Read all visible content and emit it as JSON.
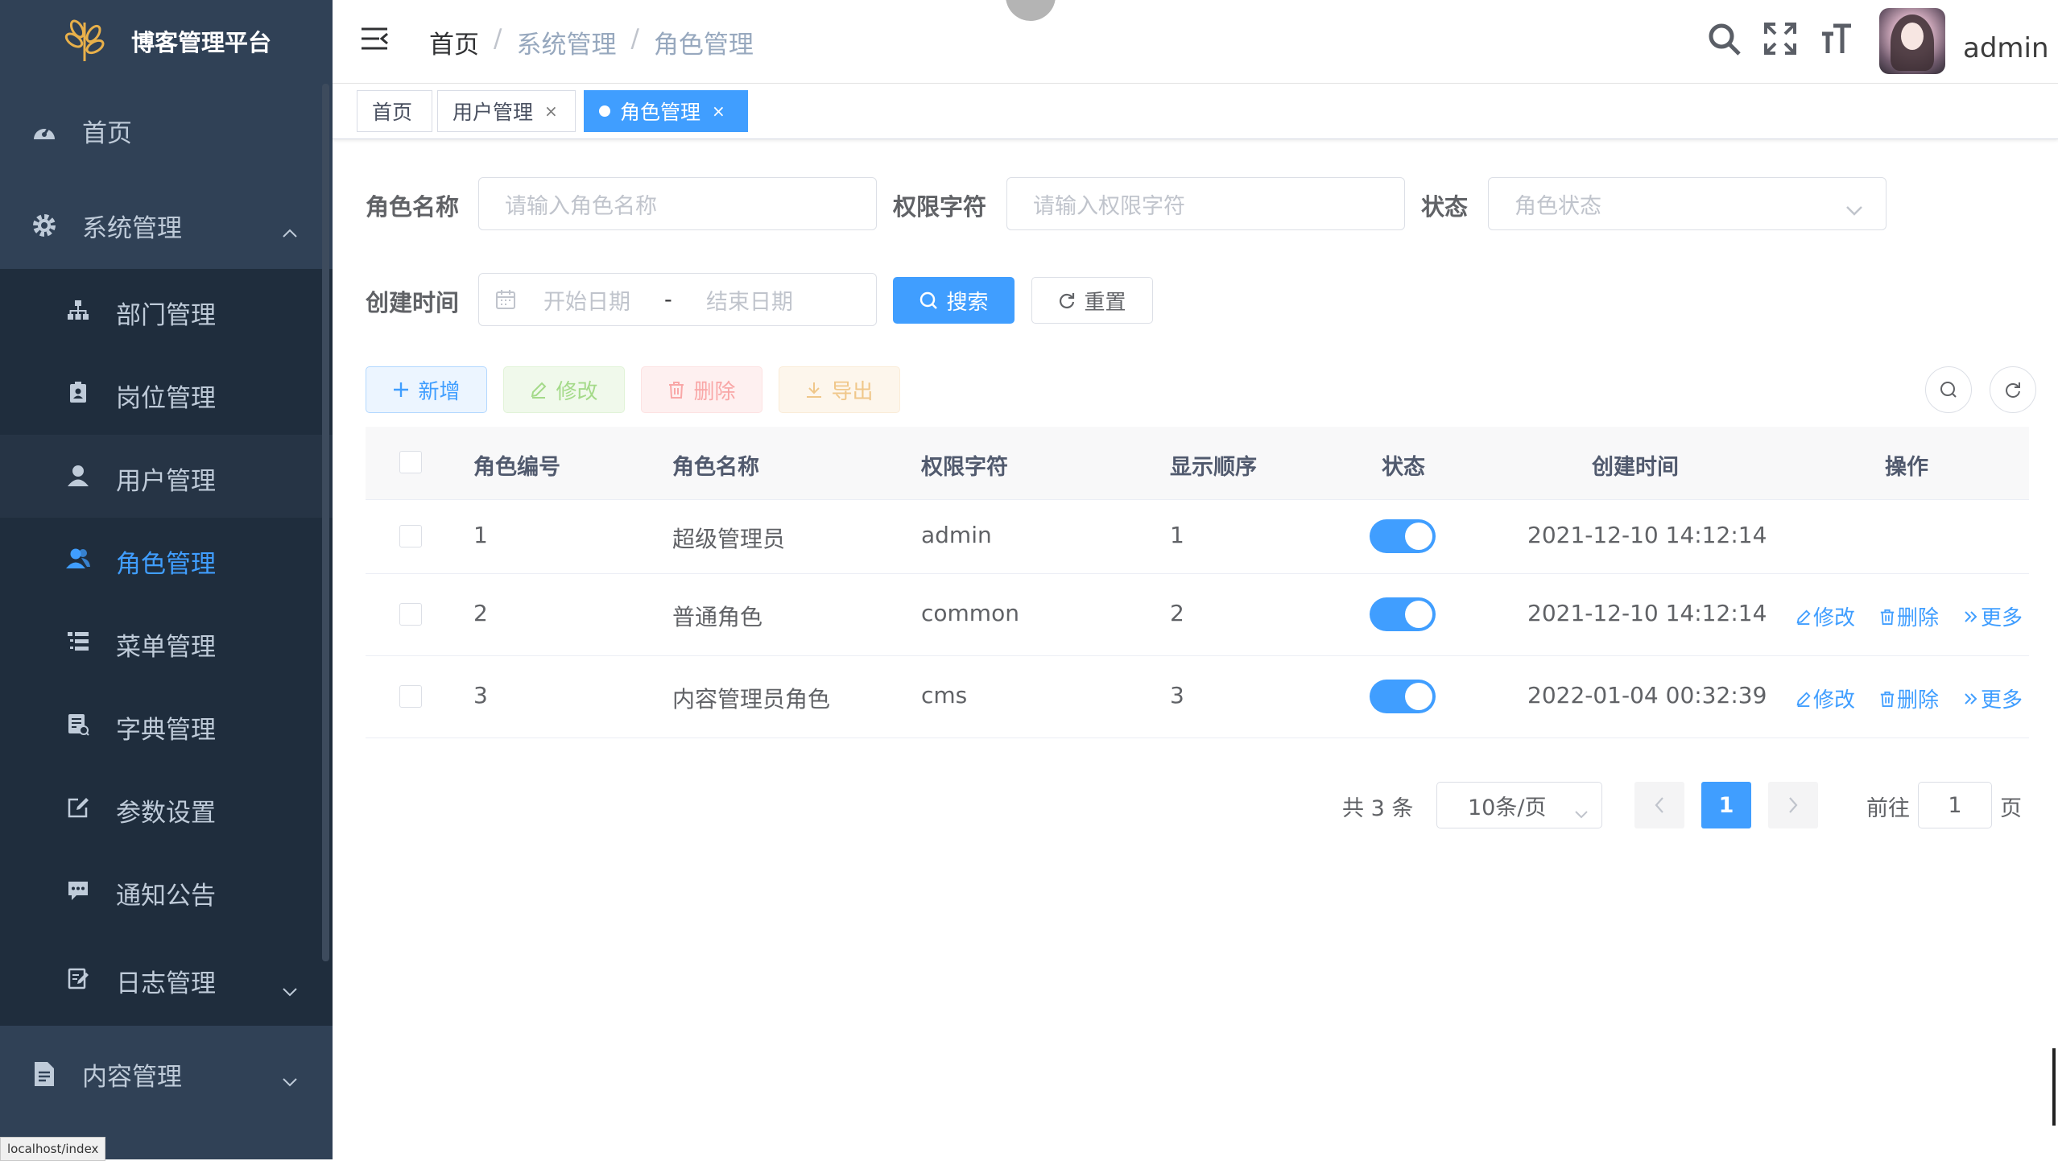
{
  "app": {
    "title": "博客管理平台",
    "status_url": "localhost/index"
  },
  "sidebar": {
    "home": "首页",
    "system": "系统管理",
    "sub_items": [
      "部门管理",
      "岗位管理",
      "用户管理",
      "角色管理",
      "菜单管理",
      "字典管理",
      "参数设置",
      "通知公告",
      "日志管理"
    ],
    "content": "内容管理"
  },
  "navbar": {
    "breadcrumb": [
      "首页",
      "系统管理",
      "角色管理"
    ],
    "username": "admin",
    "icons": [
      "search-icon",
      "fullscreen-icon",
      "font-size-icon"
    ]
  },
  "tags": {
    "home": "首页",
    "user": "用户管理",
    "role": "角色管理",
    "close": "×"
  },
  "search": {
    "role_name_label": "角色名称",
    "role_name_placeholder": "请输入角色名称",
    "perm_label": "权限字符",
    "perm_placeholder": "请输入权限字符",
    "status_label": "状态",
    "status_placeholder": "角色状态",
    "created_label": "创建时间",
    "start_placeholder": "开始日期",
    "range_sep": "-",
    "end_placeholder": "结束日期",
    "search_btn": "搜索",
    "reset_btn": "重置"
  },
  "toolbar": {
    "add": "新增",
    "edit": "修改",
    "delete": "删除",
    "export": "导出"
  },
  "table": {
    "headers": [
      "角色编号",
      "角色名称",
      "权限字符",
      "显示顺序",
      "状态",
      "创建时间",
      "操作"
    ],
    "rows": [
      {
        "id": "1",
        "name": "超级管理员",
        "key": "admin",
        "sort": "1",
        "enabled": true,
        "created": "2021-12-10 14:12:14"
      },
      {
        "id": "2",
        "name": "普通角色",
        "key": "common",
        "sort": "2",
        "enabled": true,
        "created": "2021-12-10 14:12:14"
      },
      {
        "id": "3",
        "name": "内容管理员角色",
        "key": "cms",
        "sort": "3",
        "enabled": true,
        "created": "2022-01-04 00:32:39"
      }
    ],
    "ops": {
      "edit": "修改",
      "delete": "删除",
      "more": "更多"
    }
  },
  "pagination": {
    "total": "共 3 条",
    "page_size": "10条/页",
    "current": "1",
    "goto_label": "前往",
    "goto_value": "1",
    "page_label": "页"
  },
  "colors": {
    "sidebar_bg": "#304156",
    "submenu_bg": "#1f2d3d",
    "primary": "#409eff"
  }
}
